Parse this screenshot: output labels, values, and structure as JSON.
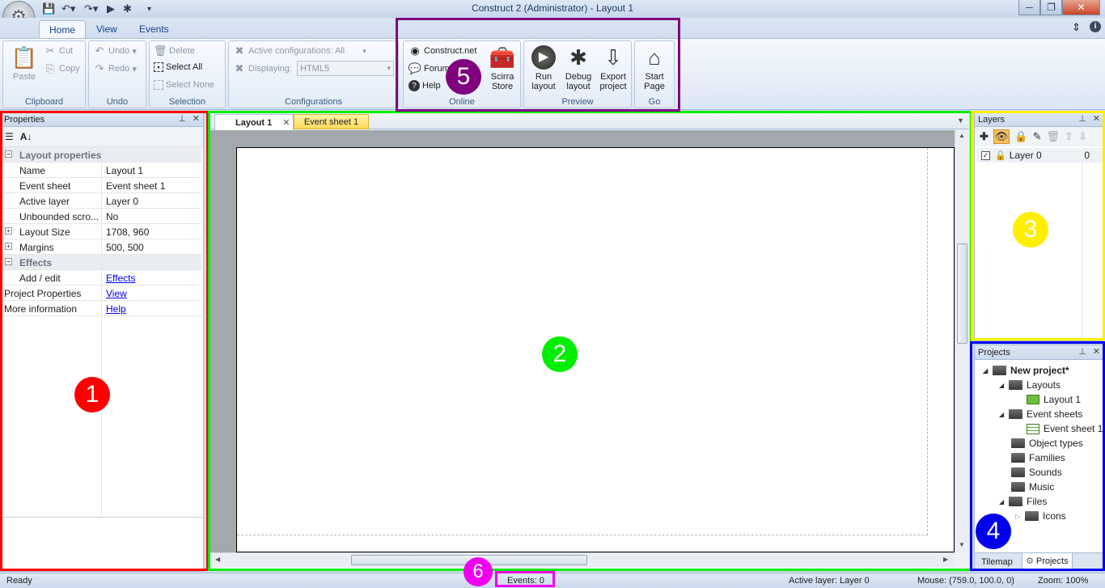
{
  "window": {
    "title": "Construct 2 (Administrator) - Layout 1",
    "minimize": "─",
    "maximize": "❐",
    "close": "✕"
  },
  "qat": {
    "save_icon": "save-icon",
    "undo_icon": "undo-icon",
    "redo_icon": "redo-icon",
    "run_icon": "run-icon",
    "debug_icon": "bug-icon",
    "more": "▾"
  },
  "ribbon_tabs": [
    "Home",
    "View",
    "Events"
  ],
  "ribbon_right": {
    "collapse": "⇕",
    "info": "i"
  },
  "clipboard": {
    "paste": "Paste",
    "cut": "Cut",
    "copy": "Copy",
    "label": "Clipboard"
  },
  "undo": {
    "undo": "Undo",
    "redo": "Redo",
    "label": "Undo"
  },
  "selection": {
    "delete": "Delete",
    "select_all": "Select All",
    "select_none": "Select None",
    "label": "Selection"
  },
  "configurations": {
    "active": "Active configurations: All",
    "displaying": "Displaying:",
    "displaying_value": "HTML5",
    "label": "Configurations"
  },
  "online": {
    "construct": "Construct.net",
    "forum": "Forum",
    "help": "Help",
    "store_line1": "Scirra",
    "store_line2": "Store",
    "label": "Online"
  },
  "preview": {
    "run1": "Run",
    "run2": "layout",
    "debug1": "Debug",
    "debug2": "layout",
    "export1": "Export",
    "export2": "project",
    "label": "Preview"
  },
  "go": {
    "start1": "Start",
    "start2": "Page",
    "label": "Go"
  },
  "properties": {
    "title": "Properties",
    "rows": [
      {
        "type": "cat",
        "key": "Layout properties",
        "sign": "⊟"
      },
      {
        "type": "kv",
        "key": "Name",
        "value": "Layout 1"
      },
      {
        "type": "kv",
        "key": "Event sheet",
        "value": "Event sheet 1"
      },
      {
        "type": "kv",
        "key": "Active layer",
        "value": "Layer 0"
      },
      {
        "type": "kv",
        "key": "Unbounded scro...",
        "value": "No"
      },
      {
        "type": "exp",
        "key": "Layout Size",
        "value": "1708, 960"
      },
      {
        "type": "exp",
        "key": "Margins",
        "value": "500, 500"
      },
      {
        "type": "cat",
        "key": "Effects",
        "sign": "⊟"
      },
      {
        "type": "link",
        "key": "Add / edit",
        "value": "Effects"
      },
      {
        "type": "rootlink",
        "key": "Project Properties",
        "value": "View"
      },
      {
        "type": "rootlink",
        "key": "More information",
        "value": "Help"
      }
    ]
  },
  "editor_tabs": [
    {
      "label": "Layout 1",
      "close": "✕"
    },
    {
      "label": "Event sheet 1"
    }
  ],
  "layers": {
    "title": "Layers",
    "items": [
      {
        "name": "Layer 0",
        "index": "0"
      }
    ]
  },
  "projects": {
    "title": "Projects",
    "root": "New project*",
    "layouts": "Layouts",
    "layout1": "Layout 1",
    "event_sheets": "Event sheets",
    "event_sheet1": "Event sheet 1",
    "object_types": "Object types",
    "families": "Families",
    "sounds": "Sounds",
    "music": "Music",
    "files": "Files",
    "icons": "Icons",
    "bottom_tabs": [
      "Tilemap",
      "Projects"
    ]
  },
  "status": {
    "ready": "Ready",
    "events": "Events: 0",
    "active_layer": "Active layer: Layer 0",
    "mouse": "Mouse: (759.0, 100.0, 0)",
    "zoom": "Zoom: 100%"
  },
  "markers": [
    "1",
    "2",
    "3",
    "4",
    "5",
    "6"
  ],
  "colors": {
    "marker1": "#ff0000",
    "marker2": "#00ee00",
    "marker3": "#ffee00",
    "marker4": "#0000ee",
    "marker5": "#800080",
    "marker6": "#ee00ee"
  }
}
